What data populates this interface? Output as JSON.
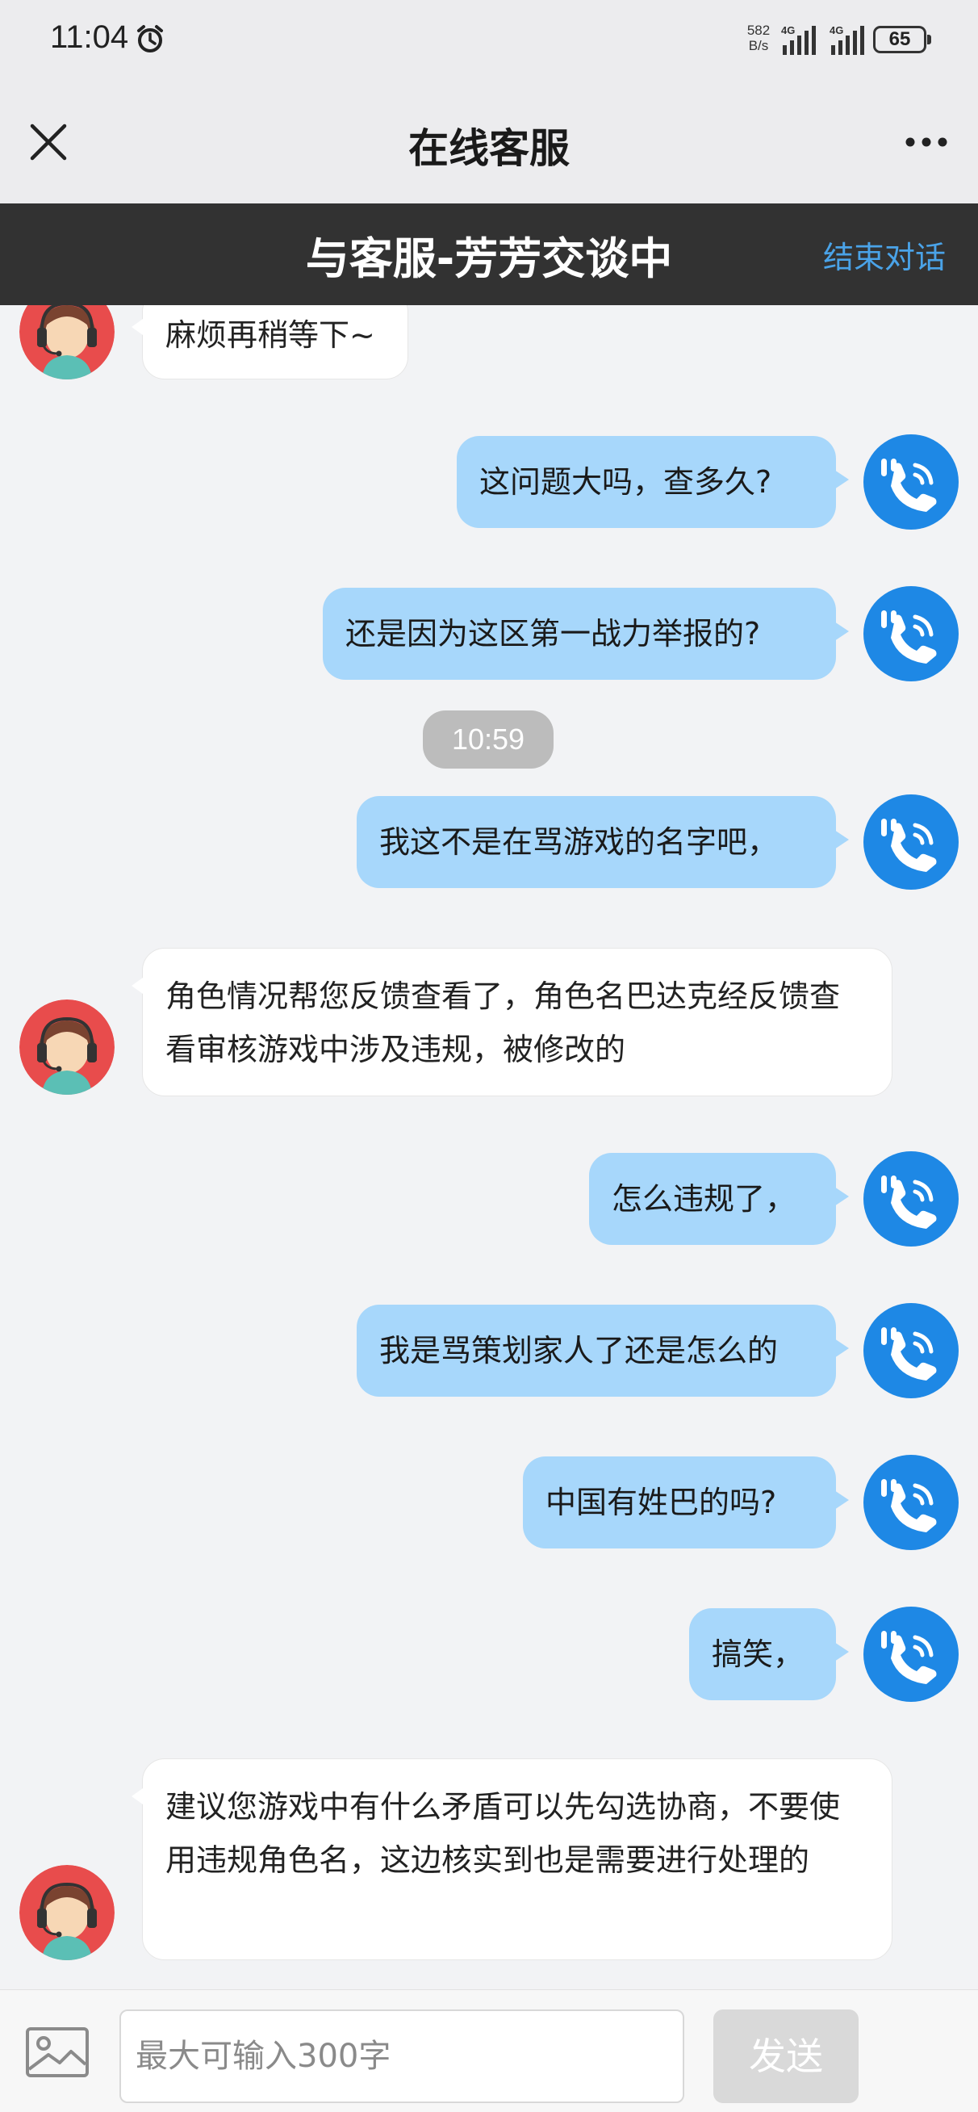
{
  "status_bar": {
    "time": "11:04",
    "net_speed_top": "582",
    "net_speed_bottom": "B/s",
    "battery": "65"
  },
  "header": {
    "title": "在线客服"
  },
  "banner": {
    "title": "与客服-芳芳交谈中",
    "end_label": "结束对话"
  },
  "messages": [
    {
      "from": "agent",
      "text": "麻烦再稍等下~"
    },
    {
      "from": "user",
      "text": "这问题大吗，查多久?"
    },
    {
      "from": "user",
      "text": "还是因为这区第一战力举报的?"
    },
    {
      "from": "user",
      "text": "我这不是在骂游戏的名字吧，"
    },
    {
      "from": "agent",
      "text": "角色情况帮您反馈查看了，角色名巴达克经反馈查看审核游戏中涉及违规，被修改的"
    },
    {
      "from": "user",
      "text": "怎么违规了，"
    },
    {
      "from": "user",
      "text": "我是骂策划家人了还是怎么的"
    },
    {
      "from": "user",
      "text": "中国有姓巴的吗?"
    },
    {
      "from": "user",
      "text": "搞笑，"
    },
    {
      "from": "agent",
      "text": "建议您游戏中有什么矛盾可以先勾选协商，不要使用违规角色名，这边核实到也是需要进行处理的"
    }
  ],
  "timestamp": "10:59",
  "input": {
    "placeholder": "最大可输入300字",
    "value": "",
    "send_label": "发送"
  },
  "colors": {
    "user_bubble": "#a7d7fb",
    "agent_bubble": "#ffffff",
    "banner_bg": "#323232",
    "end_chat_link": "#4aa3e8",
    "user_avatar": "#1e88e5"
  }
}
